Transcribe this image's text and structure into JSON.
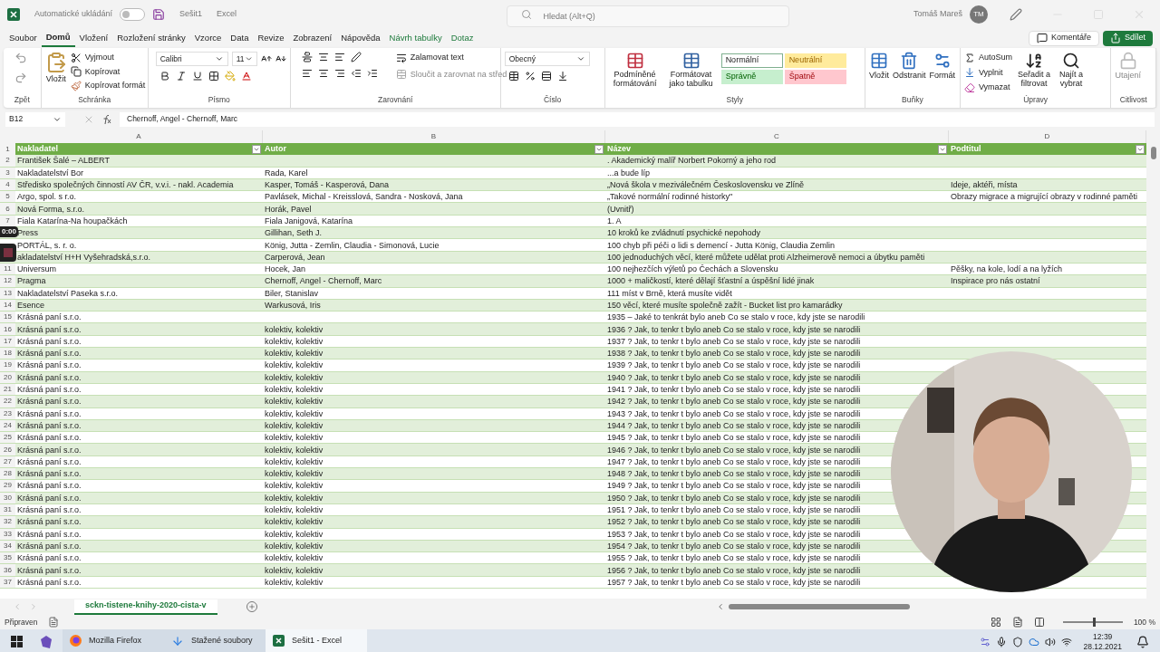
{
  "title_bar": {
    "autosave_label": "Automatické ukládání",
    "autosave_on": false,
    "document": "Sešit1",
    "app": "Excel",
    "search_placeholder": "Hledat (Alt+Q)",
    "user": "Tomáš Mareš",
    "avatar": "TM"
  },
  "menu": {
    "tabs": [
      {
        "label": "Soubor",
        "selected": false,
        "kind": "plain"
      },
      {
        "label": "Domů",
        "selected": true,
        "kind": "plain"
      },
      {
        "label": "Vložení",
        "selected": false,
        "kind": "plain"
      },
      {
        "label": "Rozložení stránky",
        "selected": false,
        "kind": "plain"
      },
      {
        "label": "Vzorce",
        "selected": false,
        "kind": "plain"
      },
      {
        "label": "Data",
        "selected": false,
        "kind": "plain"
      },
      {
        "label": "Revize",
        "selected": false,
        "kind": "plain"
      },
      {
        "label": "Zobrazení",
        "selected": false,
        "kind": "plain"
      },
      {
        "label": "Nápověda",
        "selected": false,
        "kind": "plain"
      },
      {
        "label": "Návrh tabulky",
        "selected": false,
        "kind": "contextual"
      },
      {
        "label": "Dotaz",
        "selected": false,
        "kind": "contextual"
      }
    ],
    "comments": "Komentáře",
    "share": "Sdílet"
  },
  "ribbon": {
    "undo": {
      "label": "Zpět"
    },
    "clipboard": {
      "label": "Schránka",
      "paste": "Vložit",
      "cut": "Vyjmout",
      "copy": "Kopírovat",
      "format_painter": "Kopírovat formát"
    },
    "font": {
      "label": "Písmo",
      "family": "Calibri",
      "size": "11"
    },
    "alignment": {
      "label": "Zarovnání",
      "wrap": "Zalamovat text",
      "merge": "Sloučit a zarovnat na střed",
      "merge_disabled": true
    },
    "number": {
      "label": "Číslo",
      "format": "Obecný"
    },
    "styles": {
      "label": "Styly",
      "conditional": "Podmíněné formátování",
      "as_table": "Formátovat jako tabulku",
      "cells": [
        {
          "label": "Normální",
          "color": "#ffffff"
        },
        {
          "label": "Neutrální",
          "color": "#ffeb9c"
        },
        {
          "label": "Správně",
          "color": "#c6efce"
        },
        {
          "label": "Špatně",
          "color": "#ffc7ce"
        }
      ]
    },
    "cells": {
      "label": "Buňky",
      "insert": "Vložit",
      "delete": "Odstranit",
      "format": "Formát"
    },
    "editing": {
      "label": "Úpravy",
      "autosum": "AutoSum",
      "fill": "Vyplnit",
      "clear": "Vymazat",
      "sort": "Seřadit a filtrovat",
      "find": "Najít a vybrat"
    },
    "sensitivity": {
      "label": "Citlivost",
      "button": "Utajení",
      "disabled": true
    }
  },
  "formula_bar": {
    "name_box": "B12",
    "formula": "Chernoff, Angel - Chernoff, Marc"
  },
  "sheet": {
    "column_letters": [
      "A",
      "B",
      "C",
      "D"
    ],
    "header": {
      "number": "1",
      "cells": [
        "Nakladatel",
        "Autor",
        "Název",
        "Podtitul"
      ]
    },
    "rows": [
      {
        "number": "2",
        "a": "František Šalé – ALBERT",
        "c": ". Akademický malíř Norbert Pokorný a jeho rod"
      },
      {
        "number": "3",
        "a": "Nakladatelství Bor",
        "b": "Rada, Karel",
        "c": "...a bude líp"
      },
      {
        "number": "4",
        "a": "Středisko společných činností AV ČR, v.v.i. - nakl. Academia",
        "b": "Kasper, Tomáš - Kasperová, Dana",
        "c": "„Nová škola v meziválečném Československu ve Zlíně",
        "d": "Ideje, aktéři, místa"
      },
      {
        "number": "5",
        "a": "Argo, spol. s r.o.",
        "b": "Pavlásek, Michal - Kreisslová, Sandra - Nosková, Jana",
        "c": "„Takové normální rodinné historky\"",
        "d": "Obrazy migrace a migrující obrazy v rodinné paměti"
      },
      {
        "number": "6",
        "a": "Nová Forma, s.r.o.",
        "b": "Horák, Pavel",
        "c": "(Uvnitř)"
      },
      {
        "number": "7",
        "a": "Fiala Katarína-Na houpačkách",
        "b": "Fiala Janigová, Katarína",
        "c": "1. A"
      },
      {
        "a": "Press",
        "b": "Gillihan, Seth J.",
        "c": "10 kroků ke zvládnutí psychické nepohody"
      },
      {
        "a": "PORTÁL, s. r. o.",
        "b": "König, Jutta - Zemlin, Claudia - Simonová, Lucie",
        "c": "100 chyb při péči o lidi s demencí - Jutta König, Claudia Zemlin"
      },
      {
        "a": "akladatelství H+H Vyšehradská,s.r.o.",
        "b": "Carperová, Jean",
        "c": "100 jednoduchých věcí, které můžete udělat proti Alzheimerově nemoci a úbytku paměti"
      },
      {
        "number": "11",
        "a": "Universum",
        "b": "Hocek, Jan",
        "c": "100 nejhezčích výletů po Čechách a Slovensku",
        "d": "Pěšky, na kole, lodí a na lyžích"
      },
      {
        "number": "12",
        "a": "Pragma",
        "b": "Chernoff, Angel - Chernoff, Marc",
        "c": "1000 + maličkostí, které dělají šťastní a úspěšní lidé jinak",
        "d": "Inspirace pro nás ostatní"
      },
      {
        "number": "13",
        "a": "Nakladatelství Paseka s.r.o.",
        "b": "Biler, Stanislav",
        "c": "111 míst v Brně, která musíte vidět"
      },
      {
        "number": "14",
        "a": "Esence",
        "b": "Warkusová, Iris",
        "c": "150 věcí, které musíte společně zažít - Bucket list pro kamarádky"
      },
      {
        "number": "15",
        "a": "Krásná paní s.r.o.",
        "c": "1935 – Jaké to tenkrát bylo aneb Co se stalo v roce, kdy jste se narodili"
      },
      {
        "number": "16",
        "a": "Krásná paní s.r.o.",
        "b": "kolektiv, kolektiv",
        "c": "1936 ? Jak, to tenkr t bylo aneb Co se stalo v roce, kdy jste se narodili"
      },
      {
        "number": "17",
        "a": "Krásná paní s.r.o.",
        "b": "kolektiv, kolektiv",
        "c": "1937 ? Jak, to tenkr t bylo aneb Co se stalo v roce, kdy jste se narodili"
      },
      {
        "number": "18",
        "a": "Krásná paní s.r.o.",
        "b": "kolektiv, kolektiv",
        "c": "1938 ? Jak, to tenkr t bylo aneb Co se stalo v roce, kdy jste se narodili"
      },
      {
        "number": "19",
        "a": "Krásná paní s.r.o.",
        "b": "kolektiv, kolektiv",
        "c": "1939 ? Jak, to tenkr t bylo aneb Co se stalo v roce, kdy jste se narodili"
      },
      {
        "number": "20",
        "a": "Krásná paní s.r.o.",
        "b": "kolektiv, kolektiv",
        "c": "1940 ? Jak, to tenkr t bylo aneb Co se stalo v roce, kdy jste se narodili"
      },
      {
        "number": "21",
        "a": "Krásná paní s.r.o.",
        "b": "kolektiv, kolektiv",
        "c": "1941 ? Jak, to tenkr t bylo aneb Co se stalo v roce, kdy jste se narodili"
      },
      {
        "number": "22",
        "a": "Krásná paní s.r.o.",
        "b": "kolektiv, kolektiv",
        "c": "1942 ? Jak, to tenkr t bylo aneb Co se stalo v roce, kdy jste se narodili"
      },
      {
        "number": "23",
        "a": "Krásná paní s.r.o.",
        "b": "kolektiv, kolektiv",
        "c": "1943 ? Jak, to tenkr t bylo aneb Co se stalo v roce, kdy jste se narodili"
      },
      {
        "number": "24",
        "a": "Krásná paní s.r.o.",
        "b": "kolektiv, kolektiv",
        "c": "1944 ? Jak, to tenkr t bylo aneb Co se stalo v roce, kdy jste se narodili"
      },
      {
        "number": "25",
        "a": "Krásná paní s.r.o.",
        "b": "kolektiv, kolektiv",
        "c": "1945 ? Jak, to tenkr t bylo aneb Co se stalo v roce, kdy jste se narodili"
      },
      {
        "number": "26",
        "a": "Krásná paní s.r.o.",
        "b": "kolektiv, kolektiv",
        "c": "1946 ? Jak, to tenkr t bylo aneb Co se stalo v roce, kdy jste se narodili"
      },
      {
        "number": "27",
        "a": "Krásná paní s.r.o.",
        "b": "kolektiv, kolektiv",
        "c": "1947 ? Jak, to tenkr t bylo aneb Co se stalo v roce, kdy jste se narodili"
      },
      {
        "number": "28",
        "a": "Krásná paní s.r.o.",
        "b": "kolektiv, kolektiv",
        "c": "1948 ? Jak, to tenkr t bylo aneb Co se stalo v roce, kdy jste se narodili"
      },
      {
        "number": "29",
        "a": "Krásná paní s.r.o.",
        "b": "kolektiv, kolektiv",
        "c": "1949 ? Jak, to tenkr t bylo aneb Co se stalo v roce, kdy jste se narodili"
      },
      {
        "number": "30",
        "a": "Krásná paní s.r.o.",
        "b": "kolektiv, kolektiv",
        "c": "1950 ? Jak, to tenkr t bylo aneb Co se stalo v roce, kdy jste se narodili"
      },
      {
        "number": "31",
        "a": "Krásná paní s.r.o.",
        "b": "kolektiv, kolektiv",
        "c": "1951 ? Jak, to tenkr t bylo aneb Co se stalo v roce, kdy jste se narodili"
      },
      {
        "number": "32",
        "a": "Krásná paní s.r.o.",
        "b": "kolektiv, kolektiv",
        "c": "1952 ? Jak, to tenkr t bylo aneb Co se stalo v roce, kdy jste se narodili"
      },
      {
        "number": "33",
        "a": "Krásná paní s.r.o.",
        "b": "kolektiv, kolektiv",
        "c": "1953 ? Jak, to tenkr t bylo aneb Co se stalo v roce, kdy jste se narodili"
      },
      {
        "number": "34",
        "a": "Krásná paní s.r.o.",
        "b": "kolektiv, kolektiv",
        "c": "1954 ? Jak, to tenkr t bylo aneb Co se stalo v roce, kdy jste se narodili"
      },
      {
        "number": "35",
        "a": "Krásná paní s.r.o.",
        "b": "kolektiv, kolektiv",
        "c": "1955 ? Jak, to tenkr t bylo aneb Co se stalo v roce, kdy jste se narodili"
      },
      {
        "number": "36",
        "a": "Krásná paní s.r.o.",
        "b": "kolektiv, kolektiv",
        "c": "1956 ? Jak, to tenkr t bylo aneb Co se stalo v roce, kdy jste se narodili"
      },
      {
        "number": "37",
        "a": "Krásná paní s.r.o.",
        "b": "kolektiv, kolektiv",
        "c": "1957 ? Jak, to tenkr t bylo aneb Co se stalo v roce, kdy jste se narodili"
      }
    ]
  },
  "recording": {
    "time": "0:00"
  },
  "sheet_tabs": [
    {
      "label": "sckn-tistene-knihy-2020-cista-v",
      "selected": true
    }
  ],
  "status_bar": {
    "status": "Připraven",
    "zoom": "100 %",
    "level": 0.5
  },
  "taskbar": {
    "apps": [
      {
        "label": "Mozilla Firefox",
        "selected": false,
        "kind": "browser"
      },
      {
        "label": "Stažené soubory",
        "selected": false,
        "kind": "folder"
      },
      {
        "label": "Sešit1 - Excel",
        "selected": true,
        "kind": "excel"
      }
    ],
    "time": "12:39",
    "date": "28.12.2021"
  }
}
